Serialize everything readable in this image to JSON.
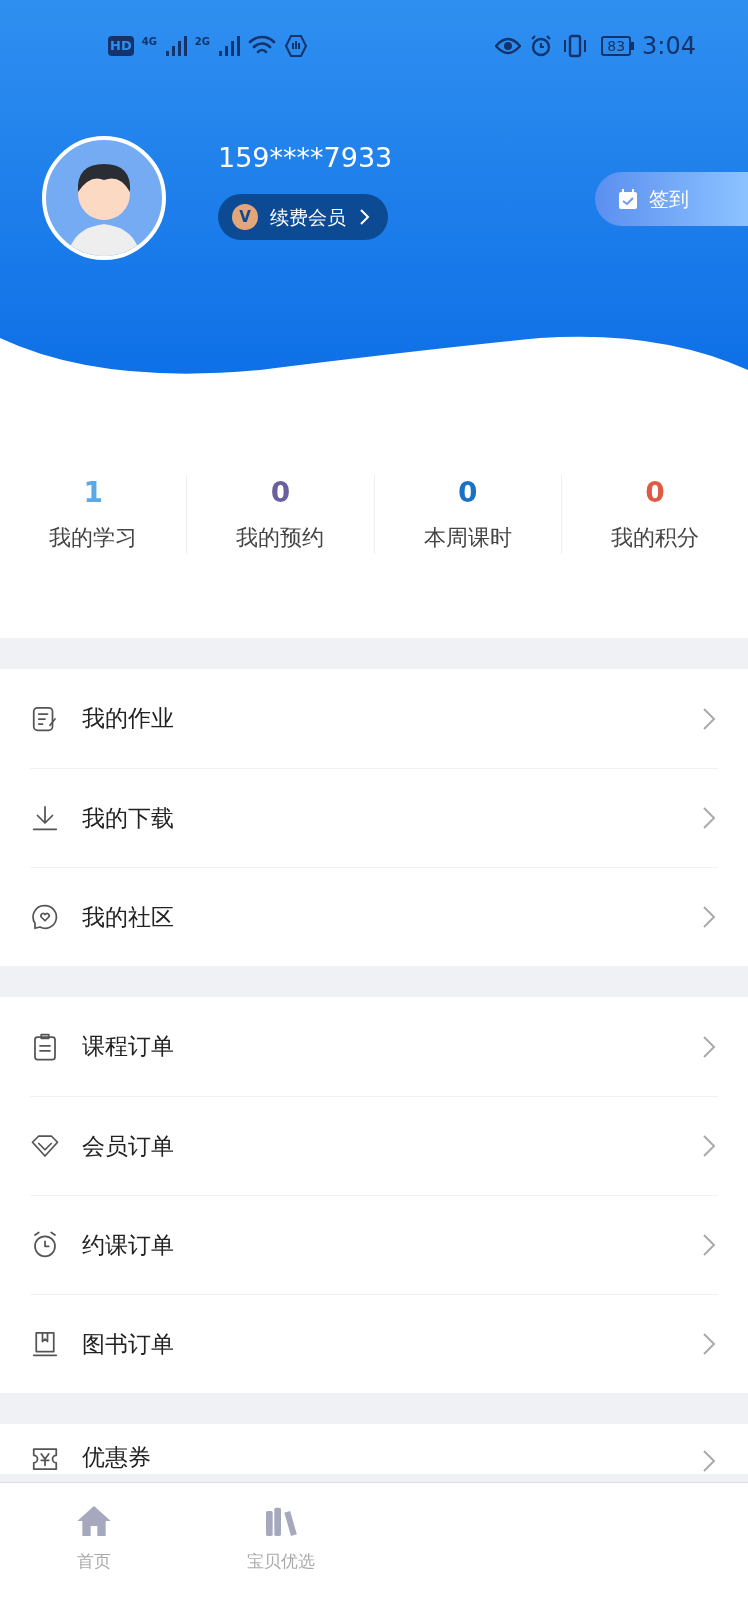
{
  "status_bar": {
    "left_badges": [
      "HD",
      "4G",
      "2G"
    ],
    "battery": "83",
    "time": "3:04"
  },
  "profile": {
    "phone": "159****7933",
    "vip_badge": "V",
    "vip_button": "续费会员",
    "checkin_button": "签到"
  },
  "stats": [
    {
      "value": "1",
      "label": "我的学习",
      "color": "#5aa9e6"
    },
    {
      "value": "0",
      "label": "我的预约",
      "color": "#6b5f9e"
    },
    {
      "value": "0",
      "label": "本周课时",
      "color": "#1a72c6"
    },
    {
      "value": "0",
      "label": "我的积分",
      "color": "#df5a44"
    }
  ],
  "menu_groups": [
    [
      {
        "label": "我的作业",
        "kind": "homework"
      },
      {
        "label": "我的下载",
        "kind": "download"
      },
      {
        "label": "我的社区",
        "kind": "community"
      }
    ],
    [
      {
        "label": "课程订单",
        "kind": "clipboard"
      },
      {
        "label": "会员订单",
        "kind": "diamond"
      },
      {
        "label": "约课订单",
        "kind": "alarm"
      },
      {
        "label": "图书订单",
        "kind": "book"
      }
    ],
    [
      {
        "label": "优惠券",
        "kind": "coupon"
      }
    ]
  ],
  "tab_bar": [
    {
      "label": "首页",
      "kind": "home"
    },
    {
      "label": "宝贝优选",
      "kind": "books"
    }
  ]
}
